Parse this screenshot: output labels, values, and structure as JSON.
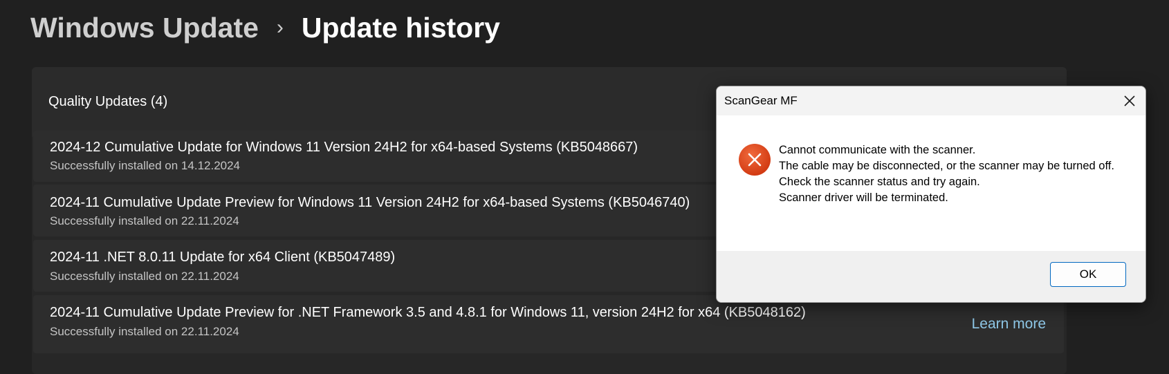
{
  "breadcrumb": {
    "parent": "Windows Update",
    "separator": "›",
    "current": "Update history"
  },
  "section": {
    "title": "Quality Updates (4)"
  },
  "updates": [
    {
      "title": "2024-12 Cumulative Update for Windows 11 Version 24H2 for x64-based Systems (KB5048667)",
      "status": "Successfully installed on 14.12.2024"
    },
    {
      "title": "2024-11 Cumulative Update Preview for Windows 11 Version 24H2 for x64-based Systems (KB5046740)",
      "status": "Successfully installed on 22.11.2024"
    },
    {
      "title": "2024-11 .NET 8.0.11 Update for x64 Client (KB5047489)",
      "status": "Successfully installed on 22.11.2024"
    },
    {
      "title": "2024-11 Cumulative Update Preview for .NET Framework 3.5 and 4.8.1 for Windows 11, version 24H2 for x64 (KB5048162)",
      "status": "Successfully installed on 22.11.2024",
      "link": "Learn more"
    }
  ],
  "dialog": {
    "title": "ScanGear MF",
    "icon": "error-icon",
    "message_lines": [
      "Cannot communicate with the scanner.",
      "The cable may be disconnected, or the scanner may be turned off.",
      "Check the scanner status and try again.",
      "Scanner driver will be terminated."
    ],
    "ok_label": "OK"
  },
  "colors": {
    "background": "#202020",
    "card": "#2d2d2d",
    "link": "#8fc8e8",
    "error": "#e0461e",
    "button_border": "#0067c0"
  }
}
